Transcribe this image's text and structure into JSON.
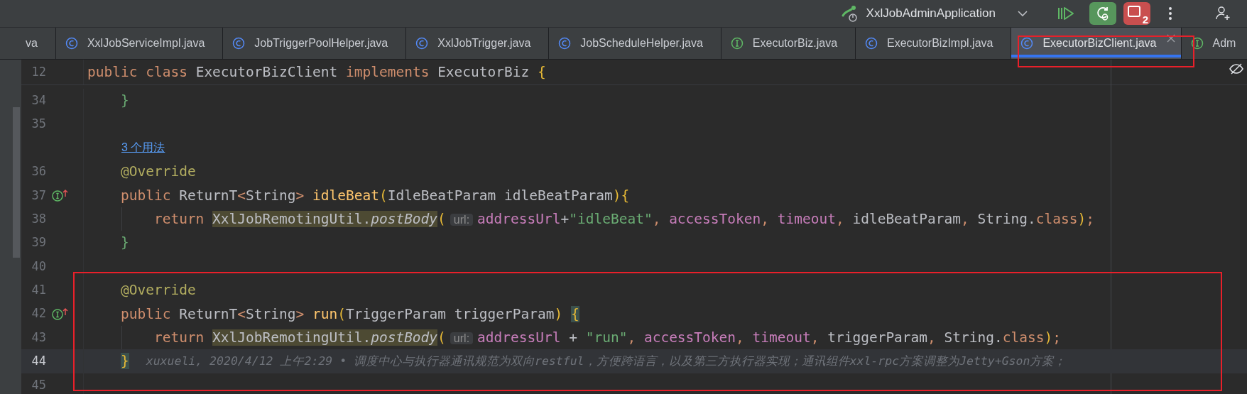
{
  "toolbar": {
    "run_config": "XxlJobAdminApplication",
    "stop_badge": "2"
  },
  "tabs": [
    {
      "label": "va",
      "kind": "plain",
      "selected": false,
      "closable": false
    },
    {
      "label": "XxlJobServiceImpl.java",
      "kind": "class",
      "selected": false,
      "closable": false
    },
    {
      "label": "JobTriggerPoolHelper.java",
      "kind": "class",
      "selected": false,
      "closable": false
    },
    {
      "label": "XxlJobTrigger.java",
      "kind": "class",
      "selected": false,
      "closable": false
    },
    {
      "label": "JobScheduleHelper.java",
      "kind": "class",
      "selected": false,
      "closable": false
    },
    {
      "label": "ExecutorBiz.java",
      "kind": "interface",
      "selected": false,
      "closable": false
    },
    {
      "label": "ExecutorBizImpl.java",
      "kind": "class",
      "selected": false,
      "closable": false
    },
    {
      "label": "ExecutorBizClient.java",
      "kind": "class",
      "selected": true,
      "closable": true
    },
    {
      "label": "Adm",
      "kind": "interface",
      "selected": false,
      "closable": false
    }
  ],
  "sticky_header": {
    "number": "12",
    "tokens": [
      {
        "t": "public class",
        "kind": "kw"
      },
      {
        "t": " ExecutorBizClient ",
        "kind": "plain"
      },
      {
        "t": "implements",
        "kind": "kw"
      },
      {
        "t": " ExecutorBiz ",
        "kind": "plain"
      },
      {
        "t": "{",
        "kind": "brace"
      }
    ]
  },
  "lines": [
    {
      "kind": "code",
      "number": "34",
      "current": false,
      "tokens": [
        {
          "t": "    }",
          "kind": "brace2"
        }
      ]
    },
    {
      "kind": "code",
      "number": "35",
      "current": false
    },
    {
      "kind": "usages",
      "text": "3 个用法"
    },
    {
      "kind": "code",
      "number": "36",
      "current": false,
      "tokens": [
        {
          "t": "    @Override",
          "kind": "ann"
        }
      ]
    },
    {
      "kind": "code",
      "number": "37",
      "current": false,
      "gutter_marker": {
        "kind": "implements"
      },
      "tokens": [
        {
          "t": "    public",
          "kind": "kw"
        },
        {
          "t": " ReturnT",
          "kind": "plain"
        },
        {
          "t": "<",
          "kind": "kw"
        },
        {
          "t": "String",
          "kind": "plain"
        },
        {
          "t": "> ",
          "kind": "kw"
        },
        {
          "t": "idleBeat",
          "kind": "decl"
        },
        {
          "t": "(",
          "kind": "brace"
        },
        {
          "t": "IdleBeatParam idleBeatParam",
          "kind": "plain"
        },
        {
          "t": "){",
          "kind": "brace"
        }
      ]
    },
    {
      "kind": "code",
      "number": "38",
      "current": false,
      "indent_guide": true,
      "tokens": [
        {
          "t": "        return ",
          "kind": "kw"
        },
        {
          "t": "XxlJobRemotingUtil.",
          "kind": "usage"
        },
        {
          "t": "postBody",
          "kind": "usage_call"
        },
        {
          "t": "(",
          "kind": "brace"
        },
        {
          "t": "url:",
          "kind": "hint"
        },
        {
          "t": "addressUrl",
          "kind": "field"
        },
        {
          "t": "+",
          "kind": "plain"
        },
        {
          "t": "\"idleBeat\"",
          "kind": "str"
        },
        {
          "t": ", ",
          "kind": "kw"
        },
        {
          "t": "accessToken",
          "kind": "field"
        },
        {
          "t": ", ",
          "kind": "kw"
        },
        {
          "t": "timeout",
          "kind": "field"
        },
        {
          "t": ", ",
          "kind": "kw"
        },
        {
          "t": "idleBeatParam",
          "kind": "plain"
        },
        {
          "t": ", ",
          "kind": "kw"
        },
        {
          "t": "String.",
          "kind": "plain"
        },
        {
          "t": "class",
          "kind": "kw"
        },
        {
          "t": ")",
          "kind": "brace"
        },
        {
          "t": ";",
          "kind": "kw"
        }
      ]
    },
    {
      "kind": "code",
      "number": "39",
      "current": false,
      "tokens": [
        {
          "t": "    }",
          "kind": "brace2"
        }
      ]
    },
    {
      "kind": "code",
      "number": "40",
      "current": false
    },
    {
      "kind": "code",
      "number": "41",
      "current": false,
      "tokens": [
        {
          "t": "    @Override",
          "kind": "ann"
        }
      ]
    },
    {
      "kind": "code",
      "number": "42",
      "current": false,
      "gutter_marker": {
        "kind": "implements"
      },
      "tokens": [
        {
          "t": "    public",
          "kind": "kw"
        },
        {
          "t": " ReturnT",
          "kind": "plain"
        },
        {
          "t": "<",
          "kind": "kw"
        },
        {
          "t": "String",
          "kind": "plain"
        },
        {
          "t": "> ",
          "kind": "kw"
        },
        {
          "t": "run",
          "kind": "decl"
        },
        {
          "t": "(",
          "kind": "brace"
        },
        {
          "t": "TriggerParam triggerParam",
          "kind": "plain"
        },
        {
          "t": ") ",
          "kind": "brace"
        },
        {
          "t": "{",
          "kind": "brace_match"
        }
      ]
    },
    {
      "kind": "code",
      "number": "43",
      "current": false,
      "indent_guide": true,
      "tokens": [
        {
          "t": "        return ",
          "kind": "kw"
        },
        {
          "t": "XxlJobRemotingUtil.",
          "kind": "usage"
        },
        {
          "t": "postBody",
          "kind": "usage_call"
        },
        {
          "t": "(",
          "kind": "brace"
        },
        {
          "t": "url:",
          "kind": "hint"
        },
        {
          "t": "addressUrl",
          "kind": "field"
        },
        {
          "t": " + ",
          "kind": "plain"
        },
        {
          "t": "\"run\"",
          "kind": "str"
        },
        {
          "t": ", ",
          "kind": "kw"
        },
        {
          "t": "accessToken",
          "kind": "field"
        },
        {
          "t": ", ",
          "kind": "kw"
        },
        {
          "t": "timeout",
          "kind": "field"
        },
        {
          "t": ", ",
          "kind": "kw"
        },
        {
          "t": "triggerParam",
          "kind": "plain"
        },
        {
          "t": ", ",
          "kind": "kw"
        },
        {
          "t": "String.",
          "kind": "plain"
        },
        {
          "t": "class",
          "kind": "kw"
        },
        {
          "t": ")",
          "kind": "brace"
        },
        {
          "t": ";",
          "kind": "kw"
        }
      ]
    },
    {
      "kind": "code",
      "number": "44",
      "current": true,
      "tokens": [
        {
          "t": "    }",
          "kind": "brace_match"
        }
      ],
      "blame": "xuxueli, 2020/4/12 上午2:29 • 调度中心与执行器通讯规范为双向restful，方便跨语言，以及第三方执行器实现；通讯组件xxl-rpc方案调整为Jetty+Gson方案；"
    },
    {
      "kind": "code",
      "number": "45",
      "current": false
    }
  ]
}
